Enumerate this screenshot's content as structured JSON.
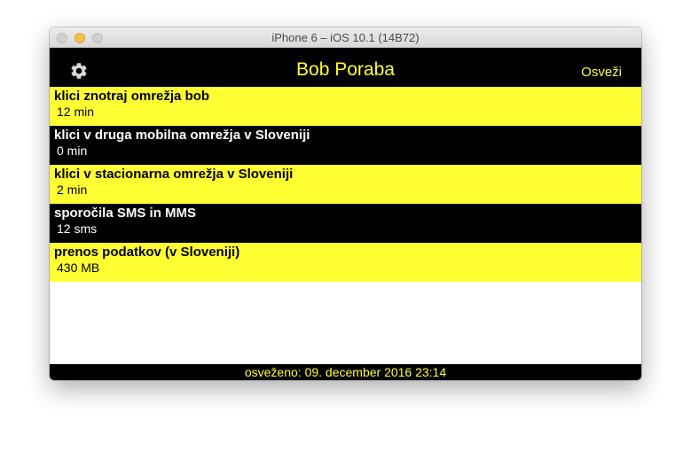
{
  "window": {
    "title": "iPhone 6 – iOS 10.1 (14B72)"
  },
  "navbar": {
    "title": "Bob Poraba",
    "settings_icon": "gear-icon",
    "refresh_label": "Osveži"
  },
  "usage": [
    {
      "label": "klici znotraj omrežja bob",
      "value": "12 min"
    },
    {
      "label": "klici v druga mobilna omrežja v Sloveniji",
      "value": "0 min"
    },
    {
      "label": "klici v stacionarna omrežja v Sloveniji",
      "value": "2 min"
    },
    {
      "label": "sporočila SMS in MMS",
      "value": "12 sms"
    },
    {
      "label": "prenos podatkov (v Sloveniji)",
      "value": "430 MB"
    }
  ],
  "footer": {
    "text": "osveženo: 09. december 2016 23:14"
  },
  "colors": {
    "accent": "#ffff33",
    "dark": "#000000"
  }
}
